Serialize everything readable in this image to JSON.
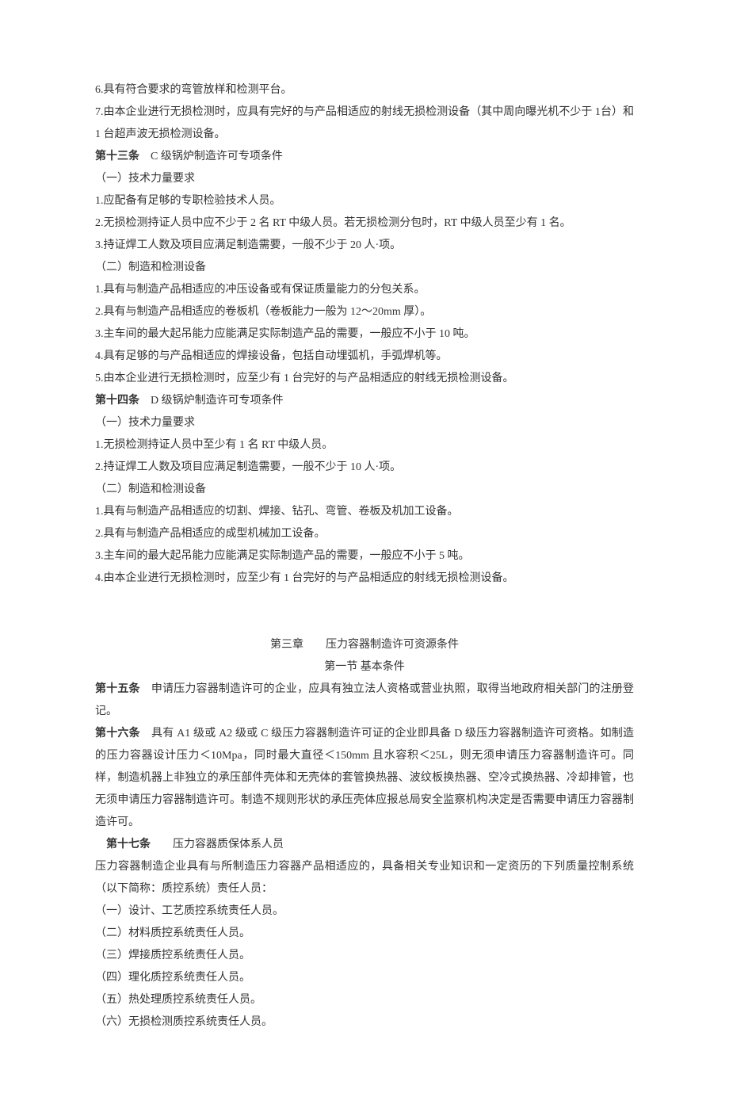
{
  "lines": [
    "6.具有符合要求的弯管放样和检测平台。",
    "7.由本企业进行无损检测时，应具有完好的与产品相适应的射线无损检测设备（其中周向曝光机不少于 1台）和 1 台超声波无损检测设备。"
  ],
  "article13": {
    "label": "第十三条",
    "title": "　C 级锅炉制造许可专项条件",
    "sub1": "（一）技术力量要求",
    "items1": [
      "1.应配备有足够的专职检验技术人员。",
      "2.无损检测持证人员中应不少于 2 名 RT 中级人员。若无损检测分包时，RT 中级人员至少有 1 名。",
      "3.持证焊工人数及项目应满足制造需要，一般不少于 20 人·项。"
    ],
    "sub2": "（二）制造和检测设备",
    "items2": [
      "1.具有与制造产品相适应的冲压设备或有保证质量能力的分包关系。",
      "2.具有与制造产品相适应的卷板机（卷板能力一般为 12～20mm 厚）。",
      "3.主车间的最大起吊能力应能满足实际制造产品的需要，一般应不小于 10 吨。",
      "4.具有足够的与产品相适应的焊接设备，包括自动埋弧机，手弧焊机等。",
      "5.由本企业进行无损检测时，应至少有 1 台完好的与产品相适应的射线无损检测设备。"
    ]
  },
  "article14": {
    "label": "第十四条",
    "title": "　D 级锅炉制造许可专项条件",
    "sub1": "（一）技术力量要求",
    "items1": [
      "1.无损检测持证人员中至少有 1 名 RT 中级人员。",
      "2.持证焊工人数及项目应满足制造需要，一般不少于 10 人·项。"
    ],
    "sub2": "（二）制造和检测设备",
    "items2": [
      "1.具有与制造产品相适应的切割、焊接、钻孔、弯管、卷板及机加工设备。",
      "2.具有与制造产品相适应的成型机械加工设备。",
      "3.主车间的最大起吊能力应能满足实际制造产品的需要，一般应不小于 5 吨。",
      "4.由本企业进行无损检测时，应至少有 1 台完好的与产品相适应的射线无损检测设备。"
    ]
  },
  "chapter": "第三章　　压力容器制造许可资源条件",
  "section": "第一节  基本条件",
  "article15": {
    "label": "第十五条",
    "text": "　申请压力容器制造许可的企业，应具有独立法人资格或营业执照，取得当地政府相关部门的注册登记。"
  },
  "article16": {
    "label": "第十六条",
    "text": "　具有 A1 级或 A2 级或 C 级压力容器制造许可证的企业即具备 D 级压力容器制造许可资格。如制造的压力容器设计压力＜10Mpa，同时最大直径＜150mm 且水容积＜25L，则无须申请压力容器制造许可。同样，制造机器上非独立的承压部件壳体和无壳体的套管换热器、波纹板换热器、空冷式换热器、冷却排管，也无须申请压力容器制造许可。制造不规则形状的承压壳体应报总局安全监察机构决定是否需要申请压力容器制造许可。"
  },
  "article17": {
    "label": "　第十七条",
    "title": "　　压力容器质保体系人员",
    "intro": "压力容器制造企业具有与所制造压力容器产品相适应的，具备相关专业知识和一定资历的下列质量控制系统（以下简称：质控系统）责任人员：",
    "items": [
      "（一）设计、工艺质控系统责任人员。",
      "（二）材料质控系统责任人员。",
      "（三）焊接质控系统责任人员。",
      "（四）理化质控系统责任人员。",
      "（五）热处理质控系统责任人员。",
      "（六）无损检测质控系统责任人员。"
    ]
  }
}
